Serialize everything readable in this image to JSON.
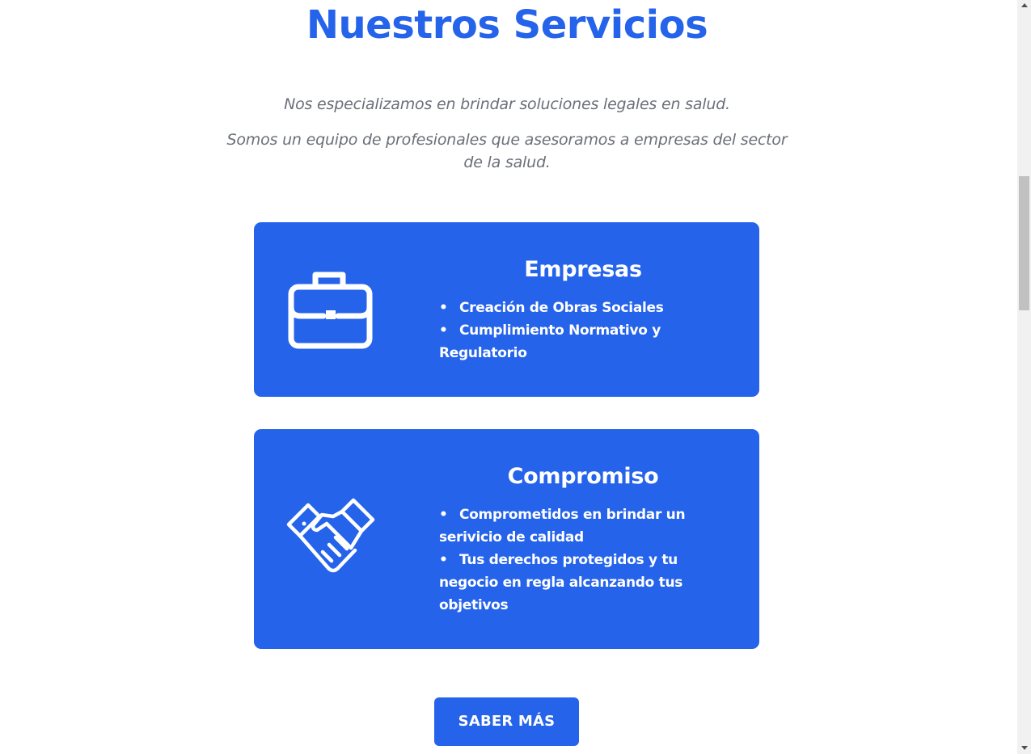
{
  "header": {
    "title": "Nuestros Servicios",
    "intro_line1": "Nos especializamos en brindar soluciones legales en salud.",
    "intro_line2": "Somos un equipo de profesionales que asesoramos a empresas del sector de la salud."
  },
  "services": [
    {
      "icon": "briefcase-icon",
      "title": "Empresas",
      "items": [
        "Creación de Obras Sociales",
        "Cumplimiento Normativo y Regulatorio"
      ]
    },
    {
      "icon": "handshake-icon",
      "title": "Compromiso",
      "items": [
        "Comprometidos en brindar un serivicio de calidad",
        "Tus derechos protegidos y tu negocio en regla alcanzando tus objetivos"
      ]
    }
  ],
  "cta": {
    "label": "SABER MÁS"
  },
  "colors": {
    "brand": "#2563eb",
    "intro_text": "#6b6f78",
    "card_text": "#ffffff"
  },
  "scrollbar": {
    "scroll_fraction": 0.24
  }
}
